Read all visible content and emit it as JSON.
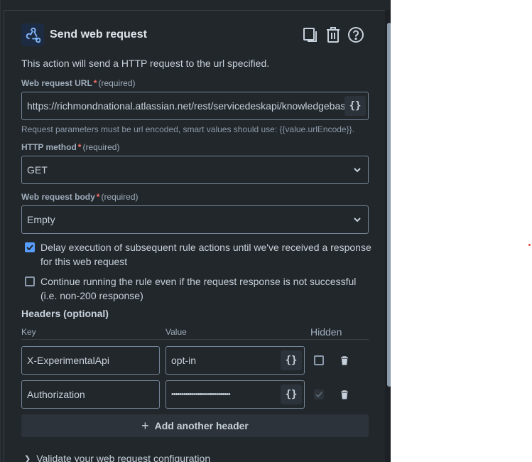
{
  "header": {
    "title": "Send web request",
    "app_icon": "webhook-icon"
  },
  "header_actions": [
    {
      "name": "duplicate-icon"
    },
    {
      "name": "delete-icon"
    },
    {
      "name": "help-icon"
    }
  ],
  "description": "This action will send a HTTP request to the url specified.",
  "url_field": {
    "label": "Web request URL",
    "required_star": "*",
    "required_text": "(required)",
    "value": "https://richmondnational.atlassian.net/rest/servicedeskapi/knowledgebase/",
    "smart_value_label": "{}",
    "hint": "Request parameters must be url encoded, smart values should use: {{value.urlEncode}}."
  },
  "method_field": {
    "label": "HTTP method",
    "required_star": "*",
    "required_text": "(required)",
    "value": "GET"
  },
  "body_field": {
    "label": "Web request body",
    "required_star": "*",
    "required_text": "(required)",
    "value": "Empty"
  },
  "options": {
    "delay": {
      "label": "Delay execution of subsequent rule actions until we've received a response for this web request",
      "checked": true
    },
    "continue": {
      "label": "Continue running the rule even if the request response is not successful (i.e. non-200 response)",
      "checked": false
    }
  },
  "headers": {
    "title": "Headers (optional)",
    "col_key": "Key",
    "col_value": "Value",
    "col_hidden": "Hidden",
    "rows": [
      {
        "key": "X-ExperimentalApi",
        "value": "opt-in",
        "hidden": false
      },
      {
        "key": "Authorization",
        "value": "•••••••••••••••••••••••••••••",
        "hidden": true
      }
    ],
    "smart_value_label": "{}",
    "add_label": "Add another header",
    "add_icon": "+"
  },
  "validate_label": "Validate your web request configuration",
  "colors": {
    "panel_bg": "#22272b",
    "field_border": "#738496",
    "text": "#c7d1db",
    "accent": "#579dff",
    "required": "#f87168"
  }
}
